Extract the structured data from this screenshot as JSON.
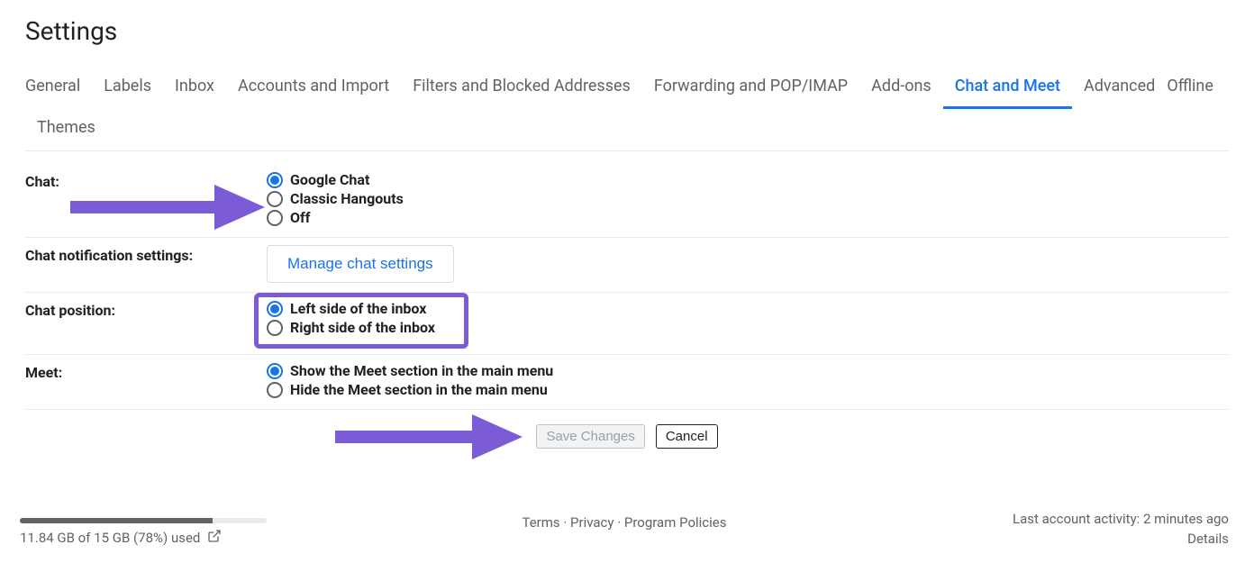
{
  "page_title": "Settings",
  "tabs": {
    "general": "General",
    "labels": "Labels",
    "inbox": "Inbox",
    "accounts": "Accounts and Import",
    "filters": "Filters and Blocked Addresses",
    "forwarding": "Forwarding and POP/IMAP",
    "addons": "Add-ons",
    "chatmeet": "Chat and Meet",
    "advanced": "Advanced",
    "offline": "Offline",
    "themes": "Themes"
  },
  "active_tab": "chatmeet",
  "sections": {
    "chat": {
      "label": "Chat:",
      "options": {
        "google_chat": "Google Chat",
        "classic_hangouts": "Classic Hangouts",
        "off": "Off"
      },
      "selected": "google_chat"
    },
    "chat_notif": {
      "label": "Chat notification settings:",
      "button": "Manage chat settings"
    },
    "chat_position": {
      "label": "Chat position:",
      "options": {
        "left": "Left side of the inbox",
        "right": "Right side of the inbox"
      },
      "selected": "left"
    },
    "meet": {
      "label": "Meet:",
      "options": {
        "show": "Show the Meet section in the main menu",
        "hide": "Hide the Meet section in the main menu"
      },
      "selected": "show"
    }
  },
  "buttons": {
    "save": "Save Changes",
    "cancel": "Cancel"
  },
  "footer": {
    "storage_text": "11.84 GB of 15 GB (78%) used",
    "storage_percent": 78,
    "terms": "Terms",
    "privacy": "Privacy",
    "policies": "Program Policies",
    "activity": "Last account activity: 2 minutes ago",
    "details": "Details"
  },
  "annotation_color": "#7b5cd6"
}
